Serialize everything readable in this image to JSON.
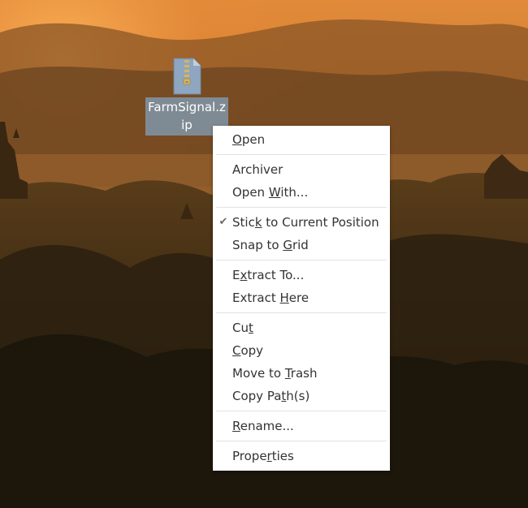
{
  "desktop": {
    "wallpaper": "sunset-temple-landscape",
    "file_icon": {
      "icon": "zip-archive-icon",
      "label": "FarmSignal.zip"
    }
  },
  "context_menu": {
    "groups": [
      [
        {
          "label": "Open",
          "mnemonic": "O"
        }
      ],
      [
        {
          "label": "Archiver"
        },
        {
          "label": "Open With...",
          "mnemonic": "W"
        }
      ],
      [
        {
          "label": "Stick to Current Position",
          "mnemonic": "k",
          "checked": true
        },
        {
          "label": "Snap to Grid",
          "mnemonic": "G"
        }
      ],
      [
        {
          "label": "Extract To...",
          "mnemonic": "x"
        },
        {
          "label": "Extract Here",
          "mnemonic": "H"
        }
      ],
      [
        {
          "label": "Cut",
          "mnemonic": "t"
        },
        {
          "label": "Copy",
          "mnemonic": "C"
        },
        {
          "label": "Move to Trash",
          "mnemonic": "T"
        },
        {
          "label": "Copy Path(s)",
          "mnemonic": "t"
        }
      ],
      [
        {
          "label": "Rename...",
          "mnemonic": "R"
        }
      ],
      [
        {
          "label": "Properties",
          "mnemonic": "r"
        }
      ]
    ]
  },
  "colors": {
    "menu_bg": "#ffffff",
    "menu_text": "#333333",
    "icon_label_bg": "#8096a8"
  }
}
